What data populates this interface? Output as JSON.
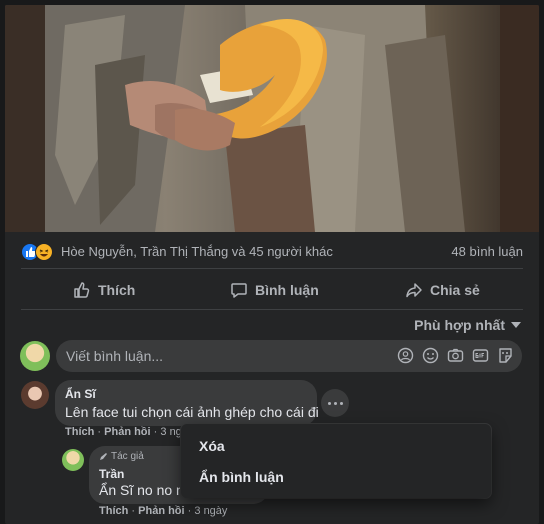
{
  "post": {
    "photo_icon": "beggar-holding-gourd-photo"
  },
  "reactions": {
    "icons": [
      "like-icon",
      "haha-icon"
    ],
    "names_text": "Hòe Nguyễn, Trần Thị Thắng và 45 người khác",
    "comment_count": "48 bình luận"
  },
  "actions": {
    "like": "Thích",
    "comment": "Bình luận",
    "share": "Chia sẻ"
  },
  "sort": {
    "label": "Phù hợp nhất"
  },
  "composer": {
    "placeholder": "Viết bình luận...",
    "tools": [
      "avatar-sticker-icon",
      "emoji-icon",
      "camera-icon",
      "gif-icon",
      "sticker-icon"
    ]
  },
  "comments": [
    {
      "author": "Ẩn Sĩ",
      "text": "Lên face tui chọn cái ảnh ghép cho cái đi",
      "like": "Thích",
      "reply": "Phản hồi",
      "time": "3 ngày"
    }
  ],
  "reply": {
    "badge": "Tác giả",
    "author": "Trần",
    "text": "Ẩn Sĩ no no no",
    "like": "Thích",
    "reply": "Phản hồi",
    "time": "3 ngày"
  },
  "menu": {
    "items": [
      "Xóa",
      "Ẩn bình luận"
    ]
  },
  "colors": {
    "background": "#18191a",
    "card": "#242526",
    "bubble": "#3a3b3c",
    "text_primary": "#e4e6eb",
    "text_secondary": "#b0b3b8",
    "like_blue": "#1877f2",
    "haha_yellow": "#f7b125"
  }
}
